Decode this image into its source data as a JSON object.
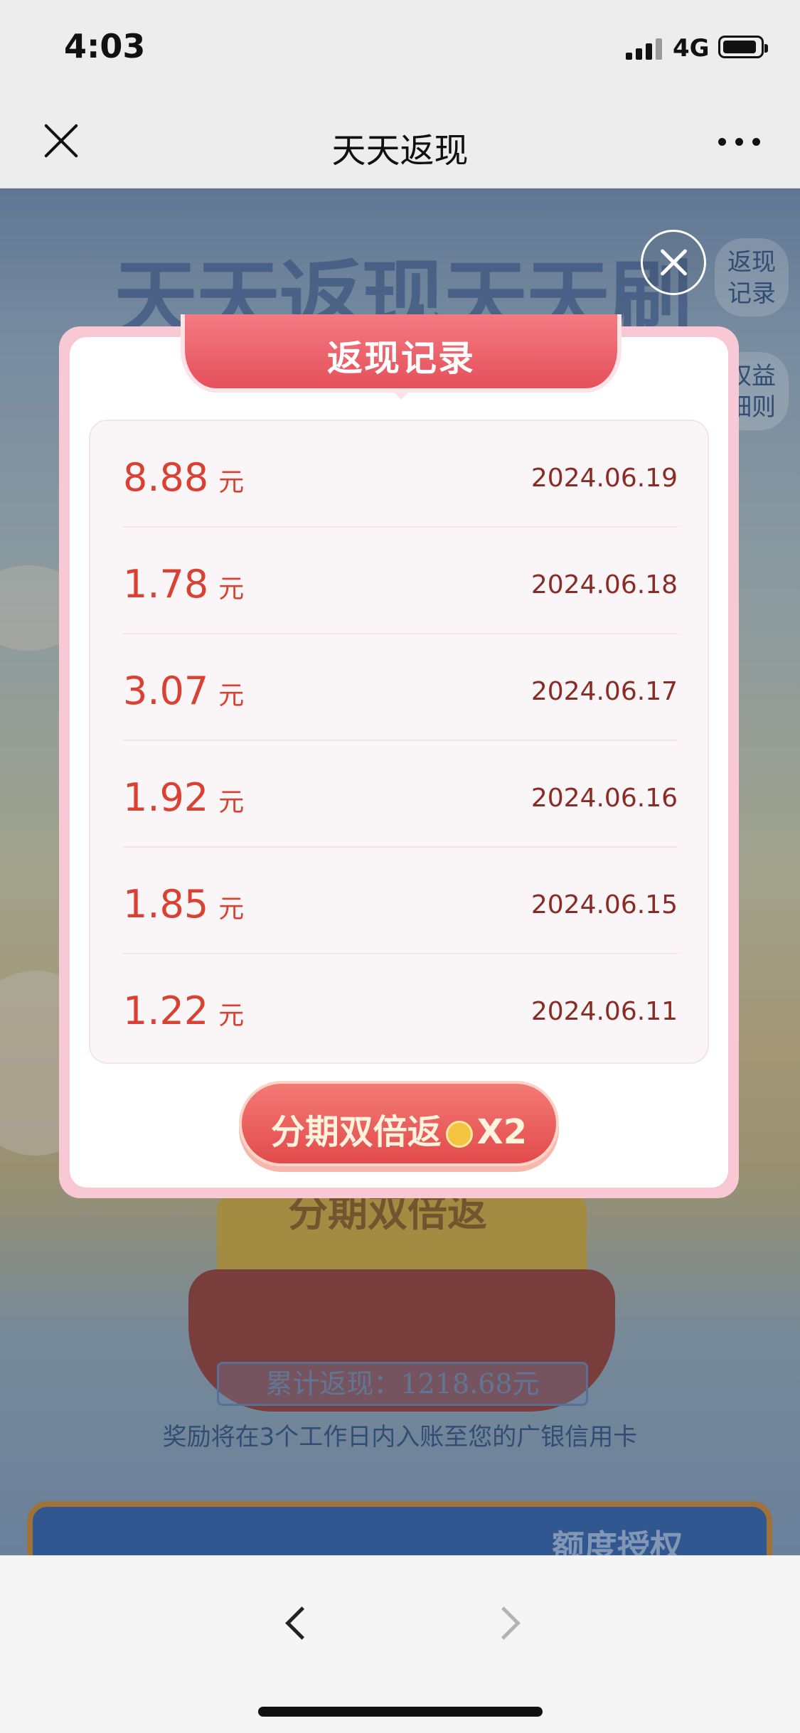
{
  "status_bar": {
    "time": "4:03",
    "network": "4G"
  },
  "nav": {
    "title": "天天返现"
  },
  "background": {
    "banner_title": "天天返现天天刷",
    "side_btn_records": "返现\n记录",
    "side_btn_rules": "权益\n细则",
    "podium_text": "分期双倍返",
    "total": "累计返现：1218.68元",
    "notice": "奖励将在3个工作日内入账至您的广银信用卡",
    "card_text": "额度授权"
  },
  "modal": {
    "title": "返现记录",
    "records": [
      {
        "amount": "8.88",
        "unit": "元",
        "date": "2024.06.19"
      },
      {
        "amount": "1.78",
        "unit": "元",
        "date": "2024.06.18"
      },
      {
        "amount": "3.07",
        "unit": "元",
        "date": "2024.06.17"
      },
      {
        "amount": "1.92",
        "unit": "元",
        "date": "2024.06.16"
      },
      {
        "amount": "1.85",
        "unit": "元",
        "date": "2024.06.15"
      },
      {
        "amount": "1.22",
        "unit": "元",
        "date": "2024.06.11"
      }
    ],
    "button_label": "分期双倍返",
    "button_multiplier": "X2"
  },
  "colors": {
    "accent_red": "#d94233",
    "date_red": "#8a2b25",
    "ribbon": "#e5505a"
  }
}
